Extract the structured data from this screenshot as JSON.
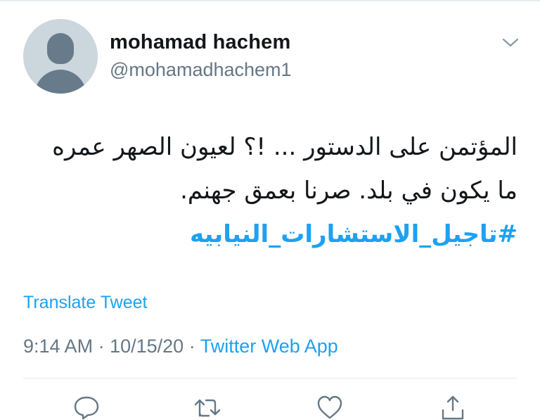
{
  "user": {
    "name": "mohamad hachem",
    "handle": "@mohamadhachem1",
    "avatar_icon": "default-avatar-icon"
  },
  "tweet": {
    "lines": [
      "المؤتمن على الدستور ... !؟ لعيون الصهر عمره",
      "ما يكون في بلد. صرنا بعمق جهنم."
    ],
    "hashtag": "#تاجيل_الاستشارات_النيابيه"
  },
  "translate_label": "Translate Tweet",
  "meta": {
    "time": "9:14 AM",
    "separator": "·",
    "date": "10/15/20",
    "source": "Twitter Web App"
  },
  "actions": [
    "reply-icon",
    "retweet-icon",
    "like-icon",
    "share-icon"
  ],
  "colors": {
    "accent": "#1da1f2",
    "text": "#14171a",
    "secondary": "#657786"
  }
}
